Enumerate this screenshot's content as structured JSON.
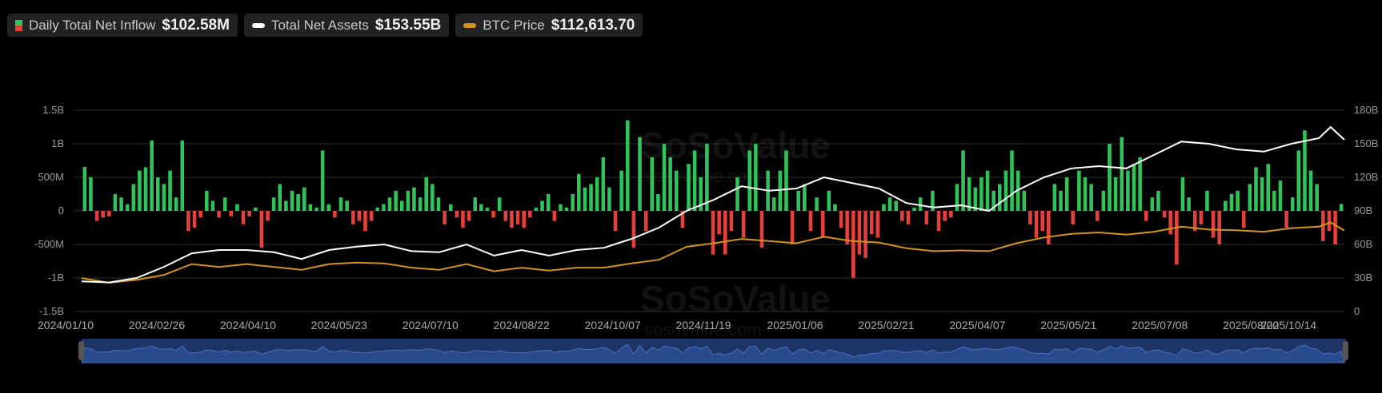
{
  "legend": {
    "inflow": {
      "label": "Daily Total Net Inflow",
      "value": "$102.58M"
    },
    "assets": {
      "label": "Total Net Assets",
      "value": "$153.55B"
    },
    "btc": {
      "label": "BTC Price",
      "value": "$112,613.70"
    }
  },
  "watermark": {
    "brand": "SoSoValue",
    "site": "sosovalue.com"
  },
  "colors": {
    "positive": "#2fc35a",
    "negative": "#e5413a",
    "assets": "#ffffff",
    "btc": "#d4931a",
    "grid": "#2e2e2e",
    "navigator": "#1e3466"
  },
  "chart_data": {
    "type": "bar",
    "title": "",
    "left_axis": {
      "unit": "USD",
      "range": [
        -1500000000,
        1500000000
      ],
      "ticks": [
        "1.5B",
        "1B",
        "500M",
        "0",
        "-500M",
        "-1B",
        "-1.5B"
      ]
    },
    "right_axis": {
      "unit": "USD",
      "range": [
        0,
        180000000000
      ],
      "ticks": [
        "180B",
        "150B",
        "120B",
        "90B",
        "60B",
        "30B",
        "0"
      ]
    },
    "btc_axis_range": [
      0,
      280000
    ],
    "x_range": [
      "2024-01-10",
      "2025-10-14"
    ],
    "x_ticks": [
      "2024/01/10",
      "2024/02/26",
      "2024/04/10",
      "2024/05/23",
      "2024/07/10",
      "2024/08/22",
      "2024/10/07",
      "2024/11/19",
      "2025/01/06",
      "2025/02/21",
      "2025/04/07",
      "2025/05/21",
      "2025/07/08",
      "2025/08/20",
      "2025/10/14"
    ],
    "grid": true,
    "inflow_series": {
      "name": "Daily Total Net Inflow",
      "unit": "M USD",
      "values": [
        655,
        500,
        -150,
        -100,
        -80,
        250,
        200,
        100,
        400,
        600,
        650,
        1050,
        500,
        400,
        600,
        200,
        1050,
        -300,
        -250,
        -100,
        300,
        150,
        -100,
        200,
        -80,
        100,
        -200,
        -80,
        50,
        -550,
        -150,
        200,
        400,
        150,
        300,
        250,
        350,
        100,
        50,
        900,
        100,
        -100,
        200,
        150,
        -200,
        -150,
        -300,
        -150,
        50,
        100,
        200,
        300,
        150,
        300,
        350,
        200,
        500,
        400,
        200,
        -200,
        100,
        -100,
        -250,
        -150,
        200,
        100,
        50,
        -100,
        200,
        -150,
        -250,
        -200,
        -250,
        -100,
        50,
        150,
        250,
        -150,
        100,
        50,
        250,
        550,
        350,
        400,
        500,
        800,
        350,
        -300,
        600,
        1350,
        -550,
        1100,
        -300,
        800,
        250,
        1000,
        800,
        600,
        -250,
        700,
        900,
        500,
        1000,
        -650,
        -350,
        -650,
        -300,
        500,
        -400,
        900,
        1000,
        -550,
        600,
        200,
        600,
        900,
        -500,
        300,
        400,
        -300,
        200,
        -400,
        300,
        100,
        -250,
        -500,
        -1000,
        -650,
        -700,
        -350,
        -400,
        100,
        200,
        150,
        -150,
        -200,
        50,
        200,
        -200,
        300,
        -300,
        -150,
        -100,
        400,
        900,
        500,
        350,
        500,
        600,
        300,
        400,
        600,
        900,
        600,
        300,
        -200,
        -400,
        -300,
        -500,
        400,
        300,
        500,
        -200,
        600,
        500,
        400,
        -150,
        300,
        1000,
        500,
        1100,
        600,
        700,
        800,
        -150,
        200,
        300,
        -100,
        -350,
        -800,
        500,
        200,
        -300,
        -200,
        300,
        -400,
        -500,
        150,
        250,
        300,
        -250,
        400,
        650,
        500,
        700,
        300,
        450,
        -250,
        200,
        900,
        1200,
        600,
        400,
        -450,
        -300,
        -500,
        102.58
      ]
    },
    "line_dates": [
      "2024-01-10",
      "2024-01-24",
      "2024-02-07",
      "2024-02-21",
      "2024-03-06",
      "2024-03-20",
      "2024-04-03",
      "2024-04-17",
      "2024-05-01",
      "2024-05-15",
      "2024-05-29",
      "2024-06-12",
      "2024-06-26",
      "2024-07-10",
      "2024-07-24",
      "2024-08-07",
      "2024-08-21",
      "2024-09-04",
      "2024-09-18",
      "2024-10-02",
      "2024-10-16",
      "2024-10-30",
      "2024-11-13",
      "2024-11-27",
      "2024-12-11",
      "2024-12-25",
      "2025-01-08",
      "2025-01-22",
      "2025-02-05",
      "2025-02-19",
      "2025-03-05",
      "2025-03-19",
      "2025-04-02",
      "2025-04-16",
      "2025-04-30",
      "2025-05-14",
      "2025-05-28",
      "2025-06-11",
      "2025-06-25",
      "2025-07-09",
      "2025-07-23",
      "2025-08-06",
      "2025-08-20",
      "2025-09-03",
      "2025-09-17",
      "2025-10-01",
      "2025-10-07",
      "2025-10-14"
    ],
    "assets_series": {
      "name": "Total Net Assets",
      "unit": "B USD",
      "values": [
        27,
        26,
        30,
        40,
        52,
        55,
        55,
        53,
        47,
        55,
        58,
        60,
        54,
        53,
        60,
        50,
        55,
        50,
        55,
        57,
        65,
        75,
        90,
        100,
        112,
        108,
        110,
        120,
        115,
        110,
        97,
        93,
        95,
        90,
        108,
        120,
        128,
        130,
        128,
        140,
        152,
        150,
        145,
        143,
        150,
        155,
        165,
        153.55
      ]
    },
    "btc_series": {
      "name": "BTC Price",
      "unit": "USD",
      "values": [
        46600,
        40000,
        44000,
        51000,
        66000,
        62000,
        66000,
        62000,
        58000,
        66000,
        68000,
        67000,
        61000,
        58000,
        66000,
        56000,
        61000,
        57000,
        61000,
        61000,
        67000,
        72000,
        90000,
        95000,
        101000,
        98000,
        95000,
        104000,
        98000,
        96000,
        88000,
        84000,
        85000,
        84000,
        95000,
        103000,
        108000,
        110000,
        107000,
        111000,
        118000,
        114000,
        113000,
        111000,
        116000,
        118000,
        124000,
        112613.7
      ]
    }
  }
}
